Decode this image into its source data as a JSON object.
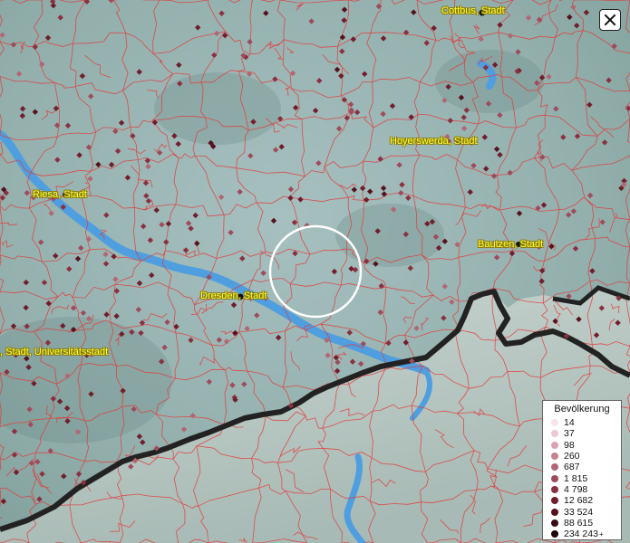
{
  "cities": [
    {
      "name": "Cottbus, Stadt",
      "id": "cottbus"
    },
    {
      "name": "Hoyerswerda, Stadt",
      "id": "hoyerswerda"
    },
    {
      "name": "Riesa, Stadt",
      "id": "riesa"
    },
    {
      "name": "Bautzen, Stadt",
      "id": "bautzen"
    },
    {
      "name": "Dresden, Stadt",
      "id": "dresden"
    },
    {
      "name": ", Stadt, Universitätsstadt",
      "id": "freiberg"
    }
  ],
  "legend": {
    "title": "Bevölkerung",
    "items": [
      {
        "label": "14",
        "color": "#f9e4ee"
      },
      {
        "label": "37",
        "color": "#eec8d6"
      },
      {
        "label": "98",
        "color": "#d9a3b3"
      },
      {
        "label": "260",
        "color": "#c6848f"
      },
      {
        "label": "687",
        "color": "#b06874"
      },
      {
        "label": "1 815",
        "color": "#9e4c5c"
      },
      {
        "label": "4 798",
        "color": "#8a3040"
      },
      {
        "label": "12 682",
        "color": "#701d2c"
      },
      {
        "label": "33 524",
        "color": "#55111d"
      },
      {
        "label": "88 615",
        "color": "#3a0a12"
      },
      {
        "label": "234 243",
        "color": "#1c0408",
        "plus": "+"
      }
    ]
  },
  "colors": {
    "boundary": "#e23a3a",
    "river": "#4f9ee0",
    "border": "#2a2a2a",
    "marker": "#8a3344",
    "label": "#ffff33"
  }
}
